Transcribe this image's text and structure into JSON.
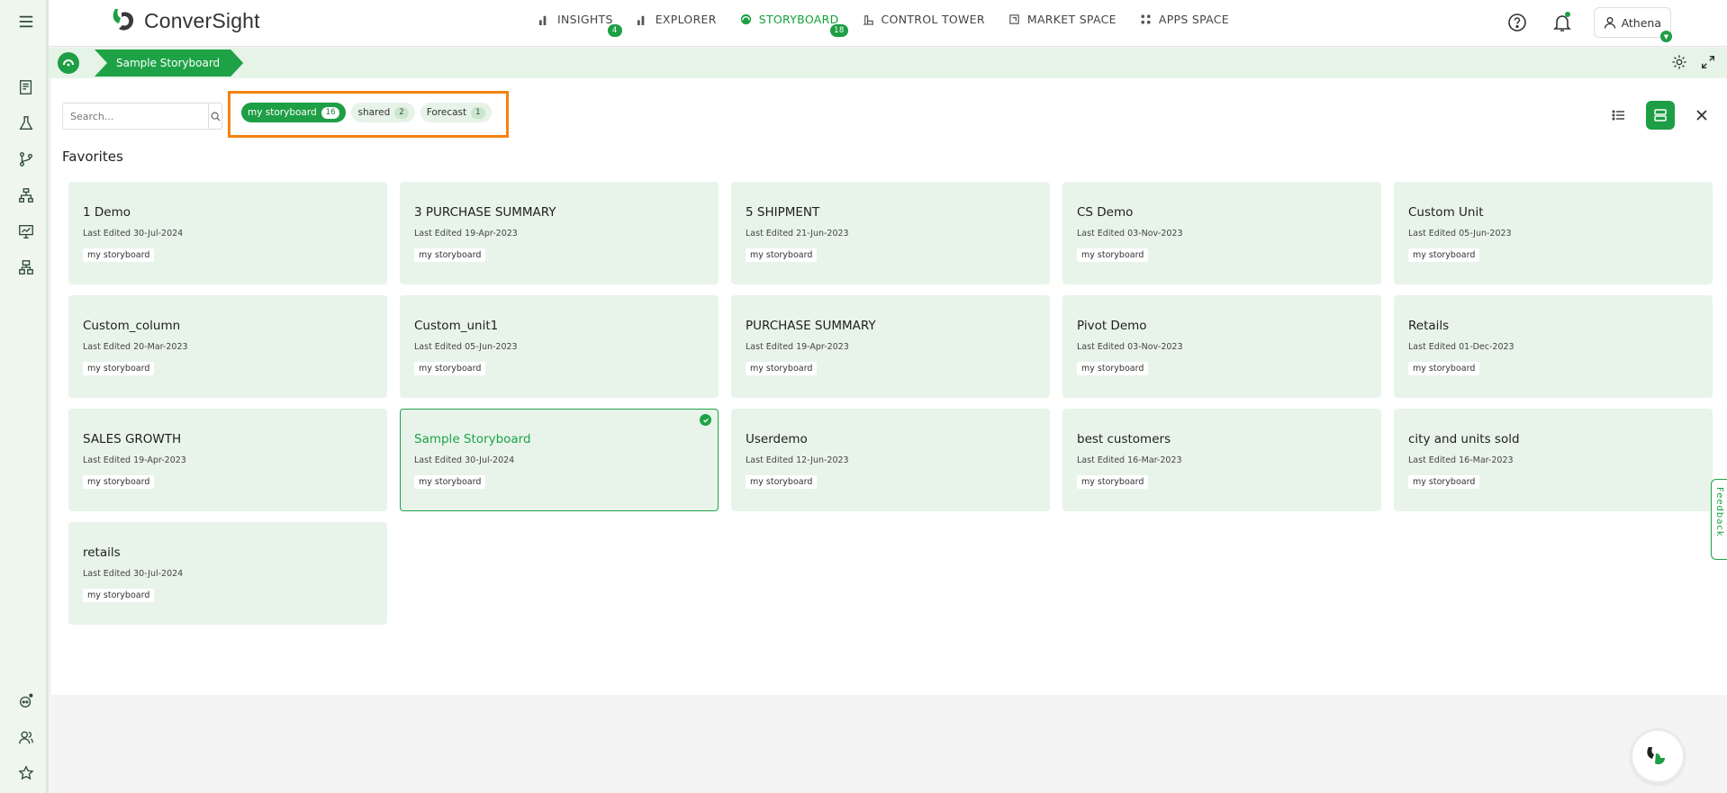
{
  "app": {
    "brand": "ConverSight",
    "accent": "#1e9e45",
    "highlight": "#f5820f"
  },
  "nav": {
    "items": [
      {
        "label": "INSIGHTS",
        "badge": "4",
        "icon": "bar-chart-icon",
        "active": false
      },
      {
        "label": "EXPLORER",
        "badge": "",
        "icon": "bar-chart-icon",
        "active": false
      },
      {
        "label": "STORYBOARD",
        "badge": "18",
        "icon": "storyboard-icon",
        "active": true
      },
      {
        "label": "CONTROL TOWER",
        "badge": "",
        "icon": "tower-icon",
        "active": false
      },
      {
        "label": "MARKET SPACE",
        "badge": "",
        "icon": "market-icon",
        "active": false
      },
      {
        "label": "APPS SPACE",
        "badge": "",
        "icon": "apps-icon",
        "active": false
      }
    ],
    "user_name": "Athena"
  },
  "breadcrumb": {
    "current": "Sample Storyboard"
  },
  "search": {
    "placeholder": "Search..."
  },
  "filters": [
    {
      "label": "my storyboard",
      "count": "16",
      "active": true
    },
    {
      "label": "shared",
      "count": "2",
      "active": false
    },
    {
      "label": "Forecast",
      "count": "1",
      "active": false
    }
  ],
  "section_title": "Favorites",
  "cards": [
    {
      "title": "1 Demo",
      "edited": "Last Edited 30-Jul-2024",
      "tag": "my storyboard"
    },
    {
      "title": "3 PURCHASE SUMMARY",
      "edited": "Last Edited 19-Apr-2023",
      "tag": "my storyboard"
    },
    {
      "title": "5 SHIPMENT",
      "edited": "Last Edited 21-Jun-2023",
      "tag": "my storyboard"
    },
    {
      "title": "CS Demo",
      "edited": "Last Edited 03-Nov-2023",
      "tag": "my storyboard"
    },
    {
      "title": "Custom Unit",
      "edited": "Last Edited 05-Jun-2023",
      "tag": "my storyboard"
    },
    {
      "title": "Custom_column",
      "edited": "Last Edited 20-Mar-2023",
      "tag": "my storyboard"
    },
    {
      "title": "Custom_unit1",
      "edited": "Last Edited 05-Jun-2023",
      "tag": "my storyboard"
    },
    {
      "title": "PURCHASE SUMMARY",
      "edited": "Last Edited 19-Apr-2023",
      "tag": "my storyboard"
    },
    {
      "title": "Pivot Demo",
      "edited": "Last Edited 03-Nov-2023",
      "tag": "my storyboard"
    },
    {
      "title": "Retails",
      "edited": "Last Edited 01-Dec-2023",
      "tag": "my storyboard"
    },
    {
      "title": "SALES GROWTH",
      "edited": "Last Edited 19-Apr-2023",
      "tag": "my storyboard"
    },
    {
      "title": "Sample Storyboard",
      "edited": "Last Edited 30-Jul-2024",
      "tag": "my storyboard",
      "selected": true
    },
    {
      "title": "Userdemo",
      "edited": "Last Edited 12-Jun-2023",
      "tag": "my storyboard"
    },
    {
      "title": "best customers",
      "edited": "Last Edited 16-Mar-2023",
      "tag": "my storyboard"
    },
    {
      "title": "city and units sold",
      "edited": "Last Edited 16-Mar-2023",
      "tag": "my storyboard"
    },
    {
      "title": "retails",
      "edited": "Last Edited 30-Jul-2024",
      "tag": "my storyboard"
    }
  ],
  "feedback_label": "Feedback"
}
